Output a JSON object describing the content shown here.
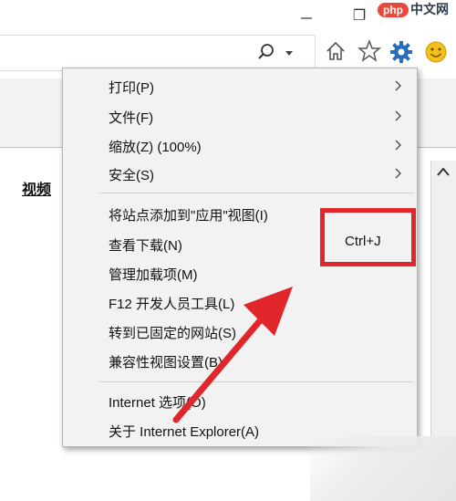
{
  "window": {
    "restore_glyph": "❐",
    "close_glyph": "✕"
  },
  "watermark": {
    "brand": "php",
    "brand_suffix": "中文网",
    "bottom_text": ""
  },
  "toolbar": {
    "icons": [
      "search-icon",
      "chevron-down-icon",
      "home-icon",
      "star-icon",
      "gear-icon",
      "smiley-icon"
    ]
  },
  "page": {
    "video_link": "视频"
  },
  "menu": {
    "group1": [
      {
        "label": "打印(P)",
        "submenu": true
      },
      {
        "label": "文件(F)",
        "submenu": true
      },
      {
        "label": "缩放(Z) (100%)",
        "submenu": true
      },
      {
        "label": "安全(S)",
        "submenu": true
      }
    ],
    "group2": [
      {
        "label": "将站点添加到\"应用\"视图(I)"
      },
      {
        "label": "查看下载(N)",
        "shortcut": "Ctrl+J"
      },
      {
        "label": "管理加载项(M)"
      },
      {
        "label": "F12 开发人员工具(L)"
      },
      {
        "label": "转到已固定的网站(S)"
      },
      {
        "label": "兼容性视图设置(B)"
      }
    ],
    "group3": [
      {
        "label": "Internet 选项(O)"
      },
      {
        "label": "关于 Internet Explorer(A)"
      }
    ]
  },
  "colors": {
    "highlight": "#e1262b",
    "gear": "#2a6ebb",
    "smiley": "#f2c018"
  }
}
